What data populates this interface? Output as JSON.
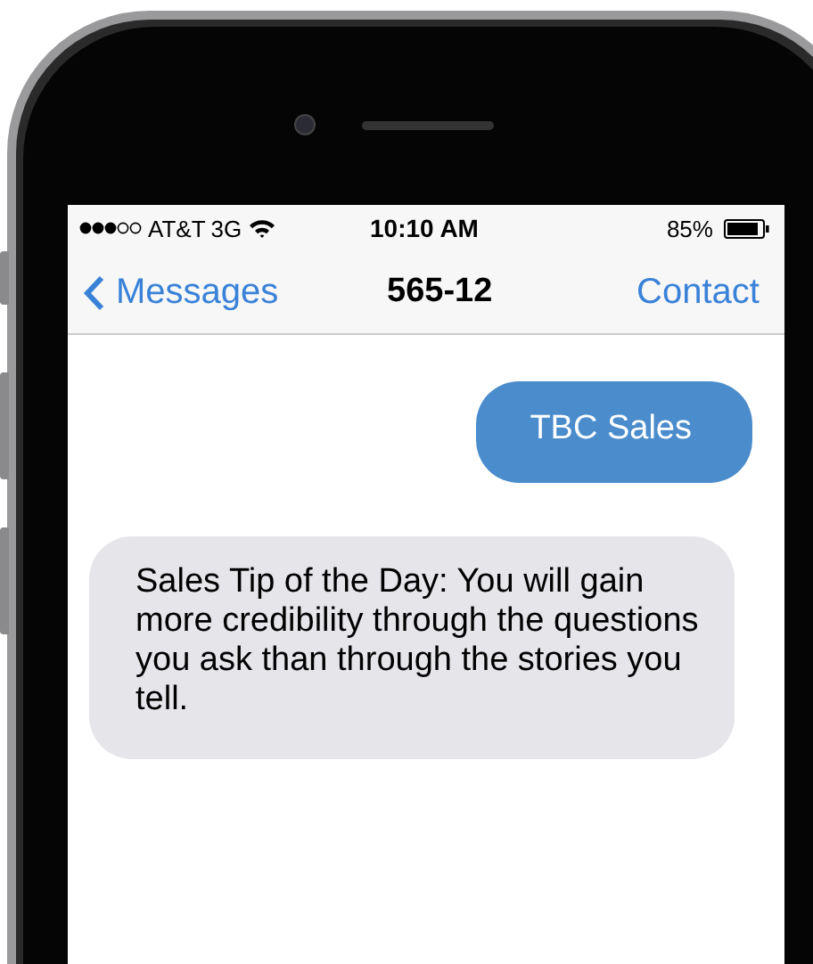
{
  "status_bar": {
    "carrier": "AT&T",
    "network": "3G",
    "time": "10:10 AM",
    "battery": "85%"
  },
  "nav": {
    "back": "Messages",
    "title": "565-12",
    "action": "Contact"
  },
  "messages": [
    {
      "kind": "sent",
      "text": "TBC Sales"
    },
    {
      "kind": "received",
      "text": "Sales Tip of the Day: You will gain more credibility through the questions you ask than through the stories you tell."
    }
  ]
}
